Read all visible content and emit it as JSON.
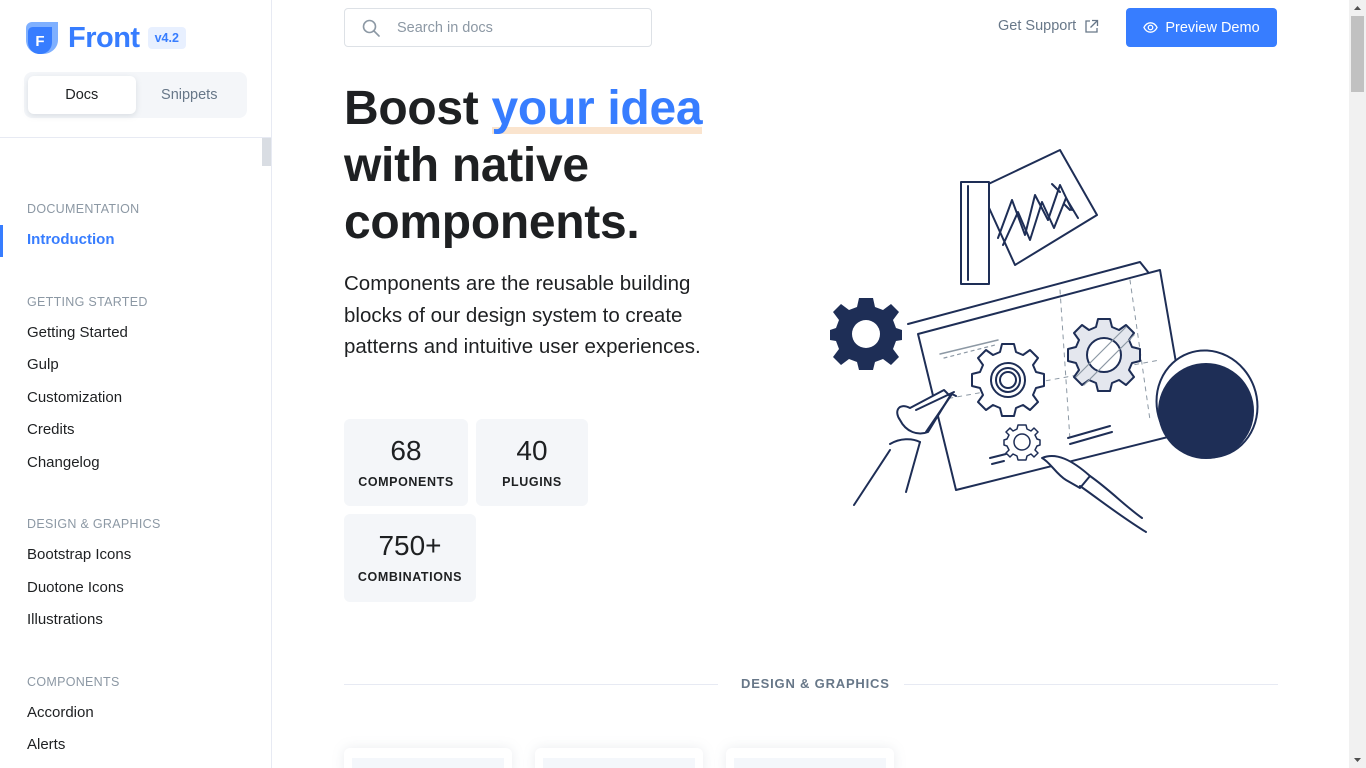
{
  "brand": {
    "name": "Front",
    "version": "v4.2"
  },
  "sidebar": {
    "tabs": [
      {
        "label": "Docs",
        "active": true
      },
      {
        "label": "Snippets",
        "active": false
      }
    ],
    "sections": [
      {
        "heading": "DOCUMENTATION",
        "items": [
          {
            "label": "Introduction",
            "active": true
          }
        ]
      },
      {
        "heading": "GETTING STARTED",
        "items": [
          {
            "label": "Getting Started"
          },
          {
            "label": "Gulp"
          },
          {
            "label": "Customization"
          },
          {
            "label": "Credits"
          },
          {
            "label": "Changelog"
          }
        ]
      },
      {
        "heading": "DESIGN & GRAPHICS",
        "items": [
          {
            "label": "Bootstrap Icons"
          },
          {
            "label": "Duotone Icons"
          },
          {
            "label": "Illustrations"
          }
        ]
      },
      {
        "heading": "COMPONENTS",
        "items": [
          {
            "label": "Accordion"
          },
          {
            "label": "Alerts"
          }
        ]
      }
    ]
  },
  "header": {
    "search": {
      "placeholder": "Search in docs",
      "icon": "search-icon"
    },
    "support_label": "Get Support",
    "support_icon": "external-link-icon",
    "demo_label": "Preview Demo",
    "demo_icon": "eye-icon"
  },
  "hero": {
    "title_part1": "Boost ",
    "title_highlight": "your idea",
    "title_part2": "with native components.",
    "lead": "Components are the reusable building blocks of our design system to create patterns and intuitive user experiences."
  },
  "stats": [
    {
      "value": "68",
      "label": "COMPONENTS"
    },
    {
      "value": "40",
      "label": "PLUGINS"
    },
    {
      "value": "750+",
      "label": "COMBINATIONS"
    }
  ],
  "section_divider": "DESIGN & GRAPHICS",
  "colors": {
    "primary": "#377dff",
    "dark": "#1e2022",
    "navy": "#1e2e56",
    "muted": "#677788",
    "soft_bg": "#f4f6f9",
    "highlight": "#f9dfc5"
  }
}
